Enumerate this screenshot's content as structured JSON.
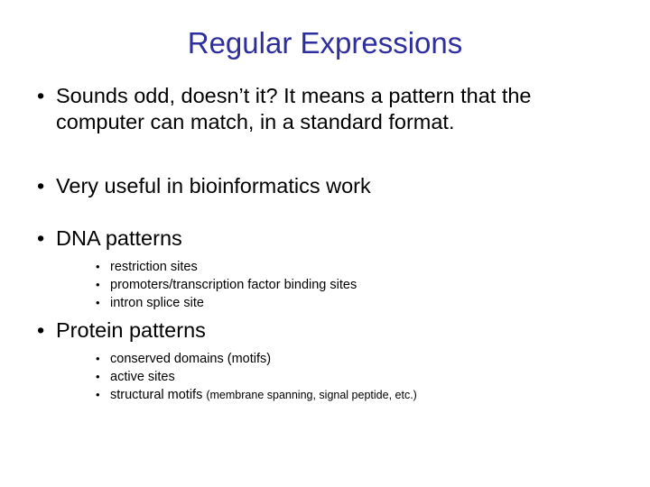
{
  "slide": {
    "title": "Regular Expressions",
    "title_color": "#2e2e9c",
    "body_color": "#000000",
    "background_color": "#ffffff",
    "bullet_glyph": "•",
    "bullets": [
      {
        "level": 1,
        "text": "Sounds odd, doesn’t it? It means a pattern that the computer can match, in a standard format."
      },
      {
        "level": 1,
        "text": "Very useful in bioinformatics work"
      },
      {
        "level": 1,
        "text": "DNA patterns"
      },
      {
        "level": 2,
        "text": "restriction sites"
      },
      {
        "level": 2,
        "text": "promoters/transcription factor binding sites"
      },
      {
        "level": 2,
        "text": "intron splice site"
      },
      {
        "level": 1,
        "text": "Protein patterns"
      },
      {
        "level": 2,
        "text": "conserved domains (motifs)"
      },
      {
        "level": 2,
        "text": "active sites"
      },
      {
        "level": 2,
        "text": "structural motifs ",
        "trailing_small": "(membrane spanning, signal peptide, etc.)"
      }
    ]
  }
}
